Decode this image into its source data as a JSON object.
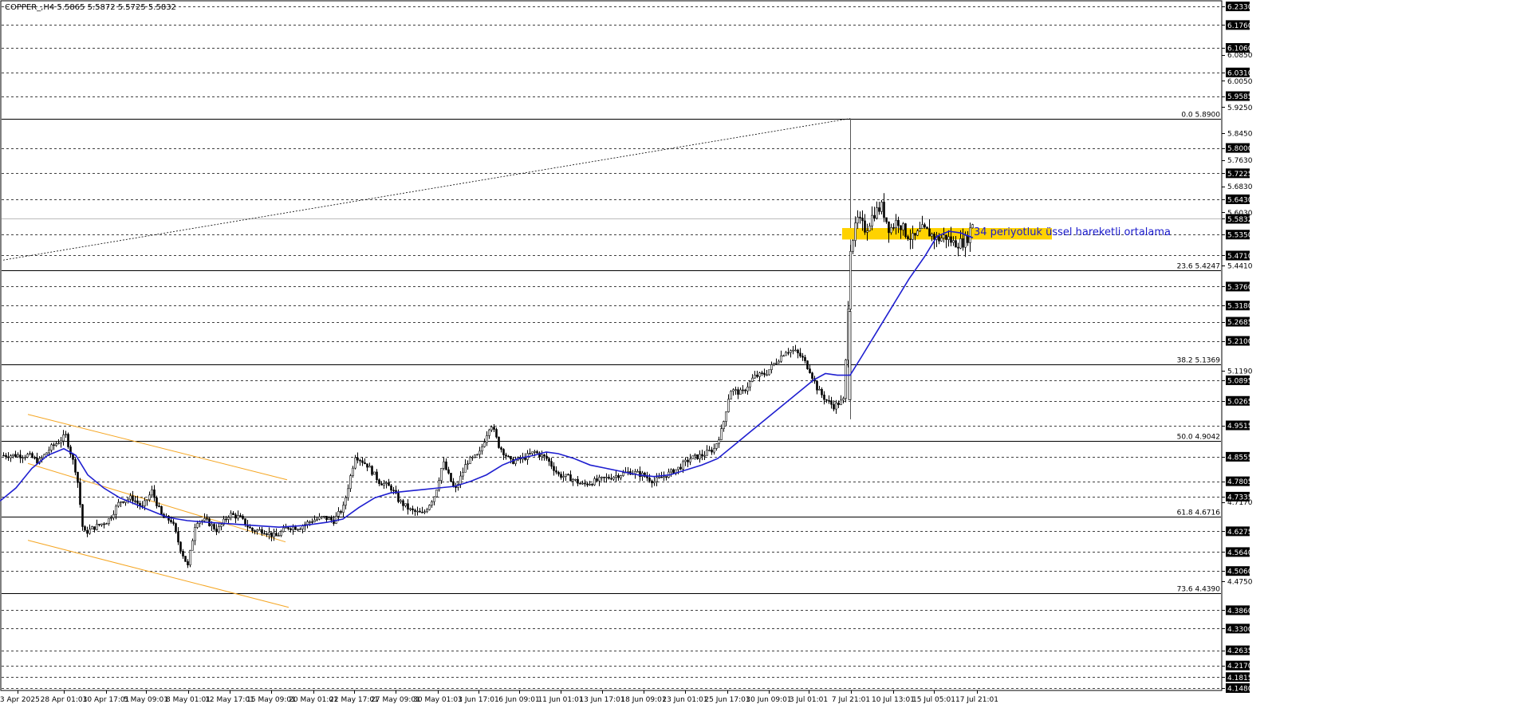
{
  "header": {
    "symbol_text": "COPPER_,H4  5.5865 5.5872 5.5725 5.5832"
  },
  "annotation": {
    "text": "34 periyotluk üssel hareketli ortalama",
    "color": "#1a1acc"
  },
  "colors": {
    "background": "#ffffff",
    "candle": "#000000",
    "ema": "#1f1fd0",
    "channel": "#f5a623",
    "zone": "#ffd200",
    "price_badge_bg": "#000000"
  },
  "chart_data": {
    "type": "candlestick",
    "title": "COPPER_,H4",
    "ohlc_last": {
      "open": 5.5865,
      "high": 5.5872,
      "low": 5.5725,
      "close": 5.5832
    },
    "y_axis": {
      "range": [
        4.148,
        6.233
      ],
      "labels": [
        "6.2330",
        "6.1760",
        "6.1060",
        "6.0850",
        "6.0310",
        "6.0050",
        "5.9585",
        "5.9250",
        "5.8450",
        "5.8000",
        "5.7630",
        "5.7225",
        "5.6830",
        "5.6430",
        "5.6030",
        "5.5832",
        "5.5350",
        "5.4710",
        "5.4410",
        "5.3760",
        "5.3180",
        "5.2685",
        "5.2100",
        "5.1190",
        "5.0895",
        "5.0265",
        "4.9515",
        "4.8555",
        "4.7805",
        "4.7335",
        "4.7170",
        "4.6275",
        "4.5640",
        "4.5060",
        "4.4750",
        "4.3860",
        "4.3300",
        "4.2635",
        "4.2170",
        "4.1815",
        "4.1480"
      ],
      "badge_labels": [
        "6.2330",
        "6.1760",
        "6.1060",
        "6.0310",
        "5.9585",
        "5.8000",
        "5.7225",
        "5.6430",
        "5.5832",
        "5.5350",
        "5.4710",
        "5.3760",
        "5.3180",
        "5.2685",
        "5.2100",
        "5.0895",
        "5.0265",
        "4.9515",
        "4.8555",
        "4.7805",
        "4.7335",
        "4.6275",
        "4.5640",
        "4.5060",
        "4.3860",
        "4.3300",
        "4.2635",
        "4.2170",
        "4.1815",
        "4.1480"
      ]
    },
    "x_axis": {
      "labels": [
        "23 Apr 2025",
        "28 Apr 01:01",
        "30 Apr 17:01",
        "5 May 09:01",
        "8 May 01:01",
        "12 May 17:01",
        "15 May 09:01",
        "20 May 01:01",
        "22 May 17:01",
        "27 May 09:01",
        "30 May 01:01",
        "3 Jun 17:01",
        "6 Jun 09:01",
        "11 Jun 01:01",
        "13 Jun 17:01",
        "18 Jun 09:01",
        "23 Jun 01:01",
        "25 Jun 17:01",
        "30 Jun 09:01",
        "3 Jul 01:01",
        "7 Jul 21:01",
        "10 Jul 13:01",
        "15 Jul 05:01",
        "17 Jul 21:01"
      ]
    },
    "fibonacci": [
      {
        "label": "0.0 5.8900",
        "level": "0.0",
        "price": 5.89
      },
      {
        "label": "23.6 5.4247",
        "level": "23.6",
        "price": 5.4247
      },
      {
        "label": "38.2 5.1369",
        "level": "38.2",
        "price": 5.1369
      },
      {
        "label": "50.0 4.9042",
        "level": "50.0",
        "price": 4.9042
      },
      {
        "label": "61.8 4.6716",
        "level": "61.8",
        "price": 4.6716
      },
      {
        "label": "73.6 4.4390",
        "level": "73.6",
        "price": 4.439
      }
    ],
    "resistance_zone": {
      "low": 5.52,
      "high": 5.555
    },
    "current_price": 5.5832,
    "ema_period": 34,
    "grid": true
  }
}
